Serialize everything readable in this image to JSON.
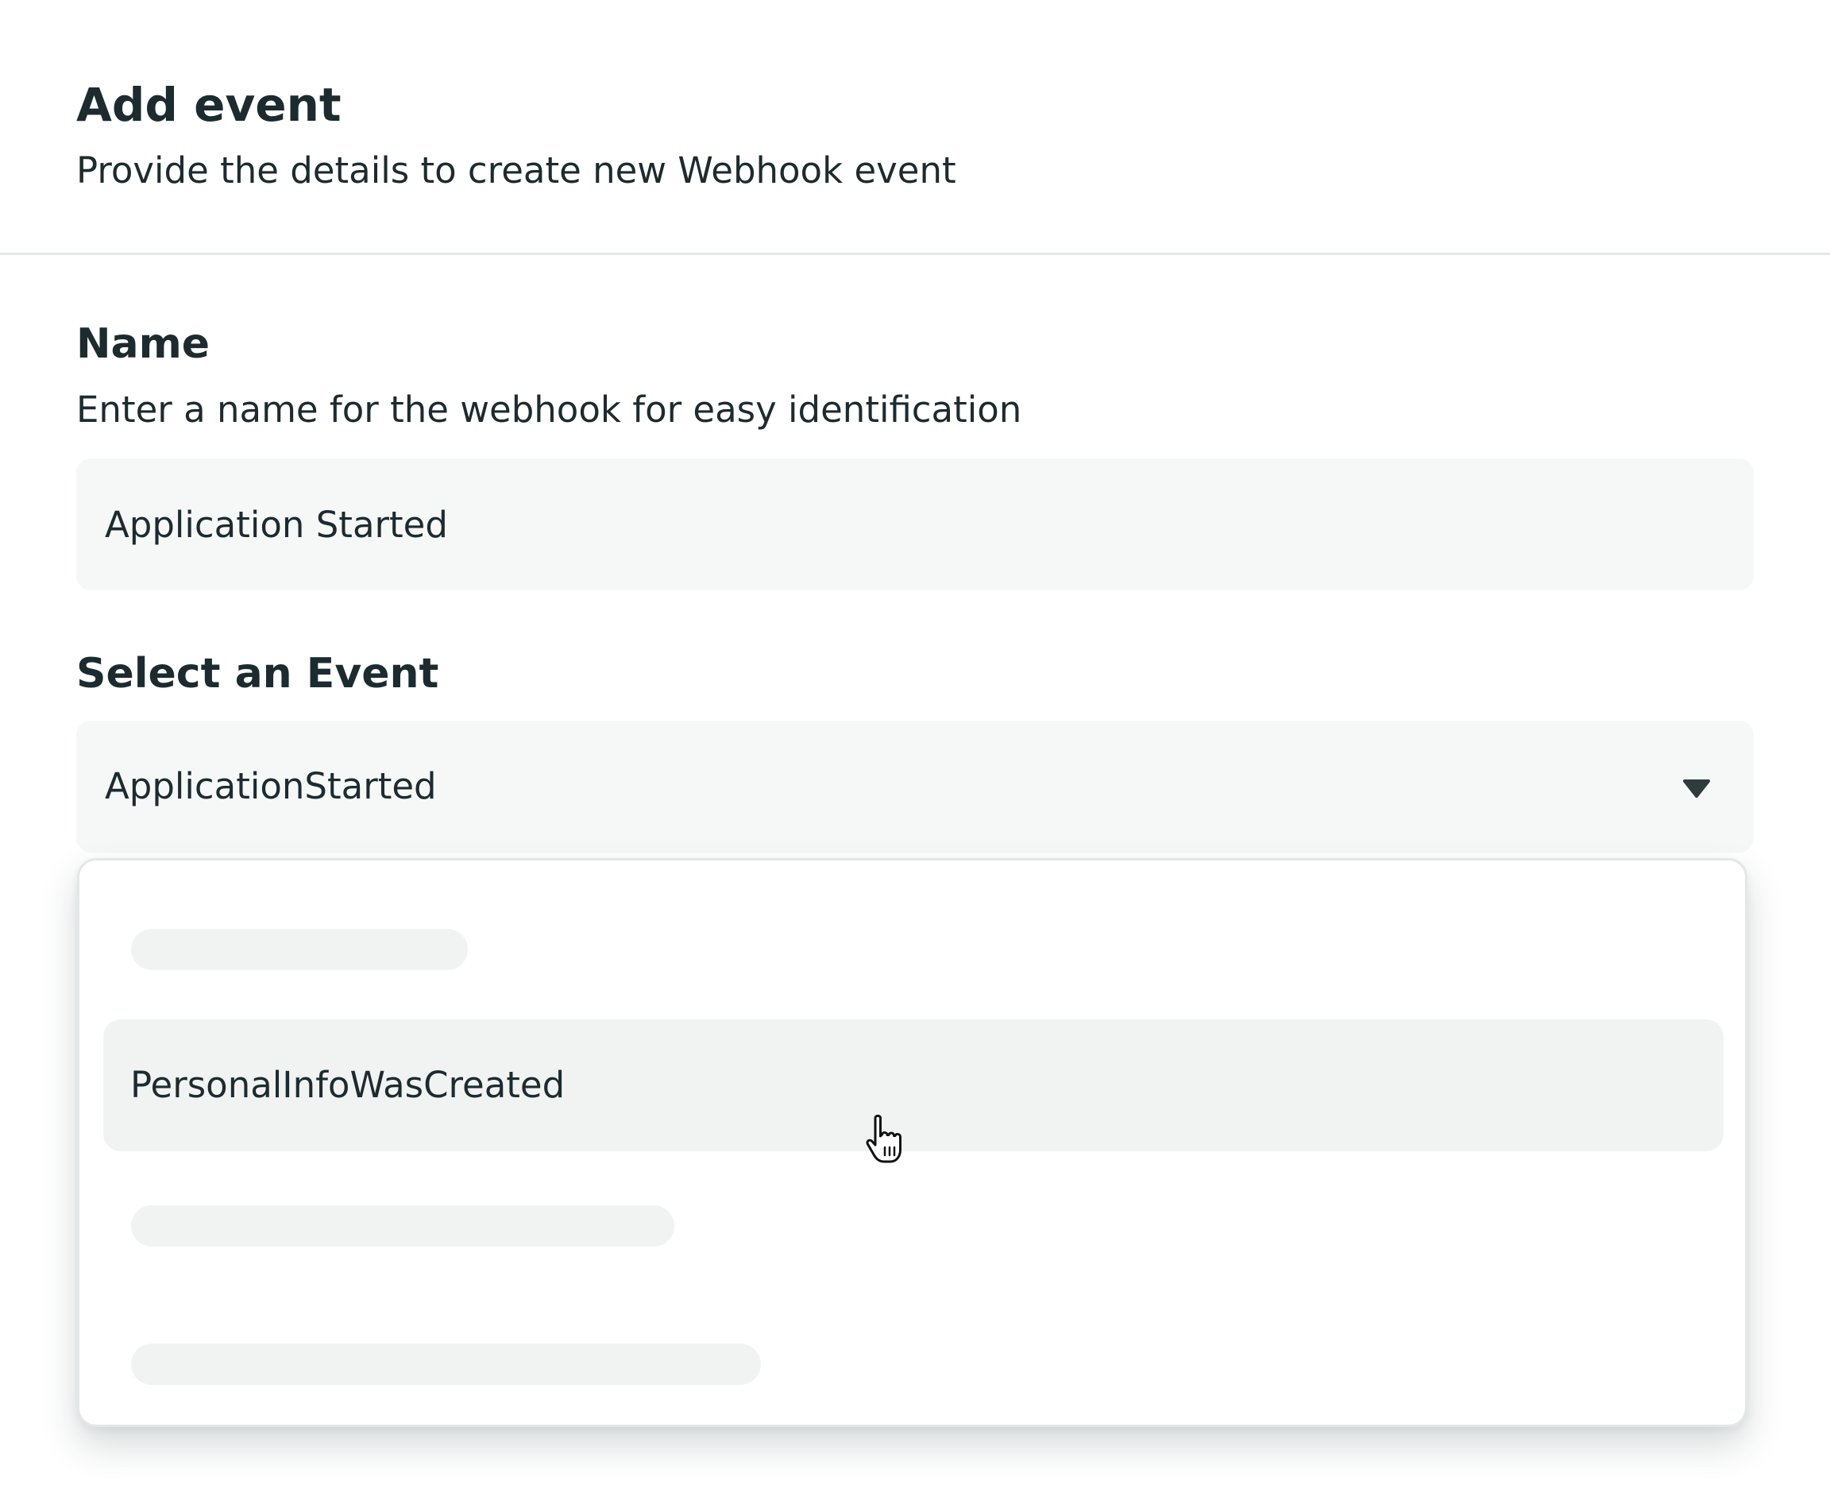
{
  "header": {
    "title": "Add event",
    "subtitle": "Provide the details to create new Webhook event"
  },
  "name_field": {
    "label": "Name",
    "help": "Enter a name for the webhook for easy identification",
    "value": "Application Started"
  },
  "event_field": {
    "label": "Select an Event",
    "selected_value": "ApplicationStarted",
    "options": [
      {
        "label": "",
        "loading": true
      },
      {
        "label": "PersonalInfoWasCreated",
        "loading": false,
        "hovered": true
      },
      {
        "label": "",
        "loading": true
      },
      {
        "label": "",
        "loading": true
      }
    ]
  },
  "icons": {
    "select_toggle": "chevron-down-icon",
    "pointer": "hand-pointer-cursor"
  },
  "colors": {
    "text": "#1c2b2f",
    "field_background": "#f6f8f8",
    "option_hover": "#f1f3f3",
    "skeleton": "#f1f3f3",
    "divider": "#e4e7e8"
  }
}
